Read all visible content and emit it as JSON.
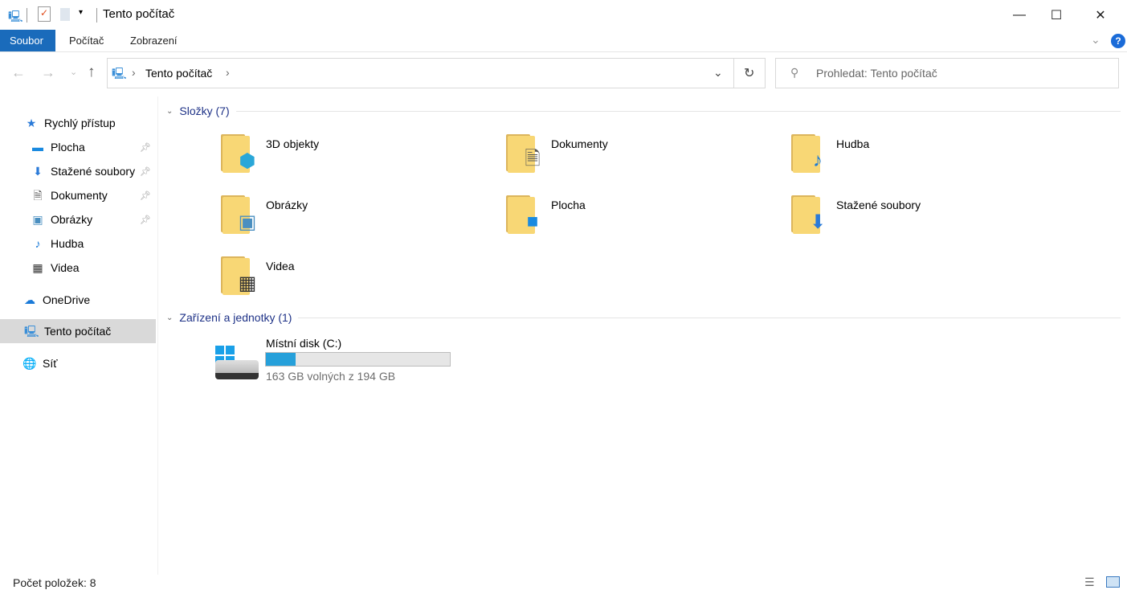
{
  "window": {
    "title": "Tento počítač"
  },
  "ribbon": {
    "tabs": [
      "Soubor",
      "Počítač",
      "Zobrazení"
    ]
  },
  "address": {
    "segment": "Tento počítač"
  },
  "search": {
    "placeholder": "Prohledat: Tento počítač"
  },
  "nav": {
    "quick_access": "Rychlý přístup",
    "pinned": [
      {
        "label": "Plocha",
        "icon": "desktop-icon"
      },
      {
        "label": "Stažené soubory",
        "icon": "download-icon"
      },
      {
        "label": "Dokumenty",
        "icon": "document-icon"
      },
      {
        "label": "Obrázky",
        "icon": "pictures-icon"
      }
    ],
    "unpinned": [
      {
        "label": "Hudba",
        "icon": "music-icon"
      },
      {
        "label": "Videa",
        "icon": "video-icon"
      }
    ],
    "onedrive": "OneDrive",
    "this_pc": "Tento počítač",
    "network": "Síť"
  },
  "groups": {
    "folders_header": "Složky (7)",
    "devices_header": "Zařízení a jednotky (1)"
  },
  "folders": [
    {
      "label": "3D objekty",
      "icon": "3d-objects-icon",
      "glyph": "⬢",
      "color": "#2aa7d8"
    },
    {
      "label": "Dokumenty",
      "icon": "documents-icon",
      "glyph": "🗎",
      "color": "#555"
    },
    {
      "label": "Hudba",
      "icon": "music-icon",
      "glyph": "♪",
      "color": "#1a7ad8"
    },
    {
      "label": "Obrázky",
      "icon": "pictures-icon",
      "glyph": "▣",
      "color": "#4a8fc0"
    },
    {
      "label": "Plocha",
      "icon": "desktop-icon",
      "glyph": "■",
      "color": "#1a8ae0"
    },
    {
      "label": "Stažené soubory",
      "icon": "download-icon",
      "glyph": "⬇",
      "color": "#2a7ad8"
    },
    {
      "label": "Videa",
      "icon": "video-icon",
      "glyph": "▦",
      "color": "#333"
    }
  ],
  "drive": {
    "label": "Místní disk (C:)",
    "free_text": "163 GB volných z 194 GB",
    "used_fraction": 0.16,
    "bar_color": "#26a0da"
  },
  "status": {
    "count": "Počet položek: 8"
  }
}
